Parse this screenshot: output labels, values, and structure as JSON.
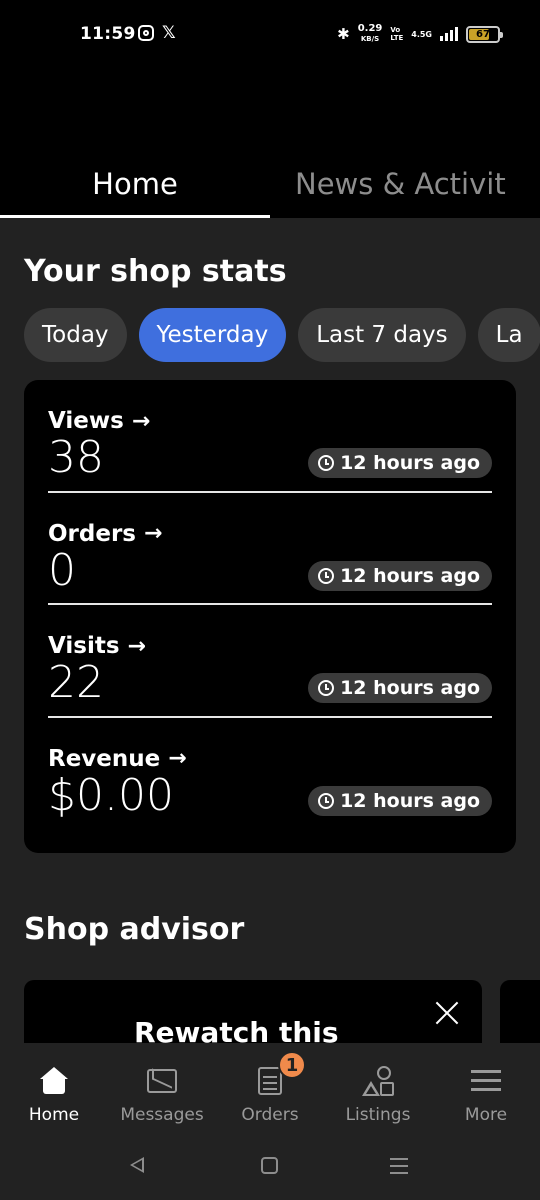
{
  "status_bar": {
    "time": "11:59",
    "net_speed": "0.29",
    "net_unit": "KB/S",
    "volte_top": "Vo",
    "volte_bottom": "LTE",
    "network_type": "4.5G",
    "battery": "67",
    "icons": [
      "instagram-icon",
      "x-icon",
      "bluetooth-icon",
      "signal-icon",
      "battery-icon"
    ]
  },
  "top_tabs": [
    {
      "label": "Home",
      "active": true
    },
    {
      "label": "News & Activit",
      "active": false
    }
  ],
  "shop_stats": {
    "title": "Your shop stats",
    "filters": [
      {
        "label": "Today",
        "active": false
      },
      {
        "label": "Yesterday",
        "active": true
      },
      {
        "label": "Last 7 days",
        "active": false
      },
      {
        "label": "La",
        "active": false
      }
    ],
    "stats": [
      {
        "label": "Views",
        "value": "38",
        "updated": "12 hours ago"
      },
      {
        "label": "Orders",
        "value": "0",
        "updated": "12 hours ago"
      },
      {
        "label": "Visits",
        "value": "22",
        "updated": "12 hours ago"
      },
      {
        "label": "Revenue",
        "value": "$0.00",
        "updated": "12 hours ago"
      }
    ]
  },
  "shop_advisor": {
    "title": "Shop advisor",
    "card_title": "Rewatch this"
  },
  "bottom_nav": [
    {
      "label": "Home",
      "icon": "home-icon",
      "active": true
    },
    {
      "label": "Messages",
      "icon": "messages-icon",
      "active": false
    },
    {
      "label": "Orders",
      "icon": "orders-icon",
      "active": false,
      "badge": "1"
    },
    {
      "label": "Listings",
      "icon": "listings-icon",
      "active": false
    },
    {
      "label": "More",
      "icon": "menu-icon",
      "active": false
    }
  ],
  "colors": {
    "accent": "#3f6fde",
    "badge": "#f08a4b",
    "surface": "#222222",
    "card": "#000000"
  }
}
